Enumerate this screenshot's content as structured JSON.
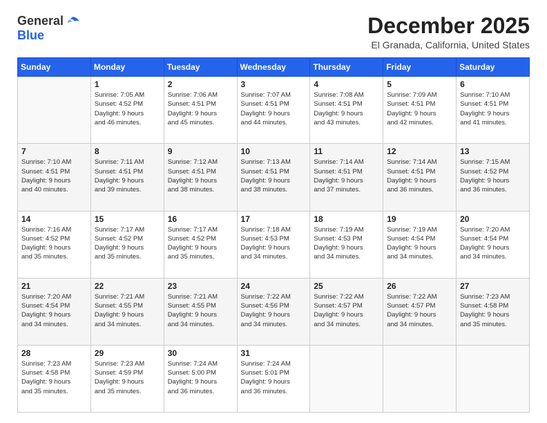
{
  "logo": {
    "general": "General",
    "blue": "Blue"
  },
  "header": {
    "month": "December 2025",
    "location": "El Granada, California, United States"
  },
  "weekdays": [
    "Sunday",
    "Monday",
    "Tuesday",
    "Wednesday",
    "Thursday",
    "Friday",
    "Saturday"
  ],
  "weeks": [
    [
      {
        "day": "",
        "info": ""
      },
      {
        "day": "1",
        "info": "Sunrise: 7:05 AM\nSunset: 4:52 PM\nDaylight: 9 hours\nand 46 minutes."
      },
      {
        "day": "2",
        "info": "Sunrise: 7:06 AM\nSunset: 4:51 PM\nDaylight: 9 hours\nand 45 minutes."
      },
      {
        "day": "3",
        "info": "Sunrise: 7:07 AM\nSunset: 4:51 PM\nDaylight: 9 hours\nand 44 minutes."
      },
      {
        "day": "4",
        "info": "Sunrise: 7:08 AM\nSunset: 4:51 PM\nDaylight: 9 hours\nand 43 minutes."
      },
      {
        "day": "5",
        "info": "Sunrise: 7:09 AM\nSunset: 4:51 PM\nDaylight: 9 hours\nand 42 minutes."
      },
      {
        "day": "6",
        "info": "Sunrise: 7:10 AM\nSunset: 4:51 PM\nDaylight: 9 hours\nand 41 minutes."
      }
    ],
    [
      {
        "day": "7",
        "info": "Sunrise: 7:10 AM\nSunset: 4:51 PM\nDaylight: 9 hours\nand 40 minutes."
      },
      {
        "day": "8",
        "info": "Sunrise: 7:11 AM\nSunset: 4:51 PM\nDaylight: 9 hours\nand 39 minutes."
      },
      {
        "day": "9",
        "info": "Sunrise: 7:12 AM\nSunset: 4:51 PM\nDaylight: 9 hours\nand 38 minutes."
      },
      {
        "day": "10",
        "info": "Sunrise: 7:13 AM\nSunset: 4:51 PM\nDaylight: 9 hours\nand 38 minutes."
      },
      {
        "day": "11",
        "info": "Sunrise: 7:14 AM\nSunset: 4:51 PM\nDaylight: 9 hours\nand 37 minutes."
      },
      {
        "day": "12",
        "info": "Sunrise: 7:14 AM\nSunset: 4:51 PM\nDaylight: 9 hours\nand 36 minutes."
      },
      {
        "day": "13",
        "info": "Sunrise: 7:15 AM\nSunset: 4:52 PM\nDaylight: 9 hours\nand 36 minutes."
      }
    ],
    [
      {
        "day": "14",
        "info": "Sunrise: 7:16 AM\nSunset: 4:52 PM\nDaylight: 9 hours\nand 35 minutes."
      },
      {
        "day": "15",
        "info": "Sunrise: 7:17 AM\nSunset: 4:52 PM\nDaylight: 9 hours\nand 35 minutes."
      },
      {
        "day": "16",
        "info": "Sunrise: 7:17 AM\nSunset: 4:52 PM\nDaylight: 9 hours\nand 35 minutes."
      },
      {
        "day": "17",
        "info": "Sunrise: 7:18 AM\nSunset: 4:53 PM\nDaylight: 9 hours\nand 34 minutes."
      },
      {
        "day": "18",
        "info": "Sunrise: 7:19 AM\nSunset: 4:53 PM\nDaylight: 9 hours\nand 34 minutes."
      },
      {
        "day": "19",
        "info": "Sunrise: 7:19 AM\nSunset: 4:54 PM\nDaylight: 9 hours\nand 34 minutes."
      },
      {
        "day": "20",
        "info": "Sunrise: 7:20 AM\nSunset: 4:54 PM\nDaylight: 9 hours\nand 34 minutes."
      }
    ],
    [
      {
        "day": "21",
        "info": "Sunrise: 7:20 AM\nSunset: 4:54 PM\nDaylight: 9 hours\nand 34 minutes."
      },
      {
        "day": "22",
        "info": "Sunrise: 7:21 AM\nSunset: 4:55 PM\nDaylight: 9 hours\nand 34 minutes."
      },
      {
        "day": "23",
        "info": "Sunrise: 7:21 AM\nSunset: 4:55 PM\nDaylight: 9 hours\nand 34 minutes."
      },
      {
        "day": "24",
        "info": "Sunrise: 7:22 AM\nSunset: 4:56 PM\nDaylight: 9 hours\nand 34 minutes."
      },
      {
        "day": "25",
        "info": "Sunrise: 7:22 AM\nSunset: 4:57 PM\nDaylight: 9 hours\nand 34 minutes."
      },
      {
        "day": "26",
        "info": "Sunrise: 7:22 AM\nSunset: 4:57 PM\nDaylight: 9 hours\nand 34 minutes."
      },
      {
        "day": "27",
        "info": "Sunrise: 7:23 AM\nSunset: 4:58 PM\nDaylight: 9 hours\nand 35 minutes."
      }
    ],
    [
      {
        "day": "28",
        "info": "Sunrise: 7:23 AM\nSunset: 4:58 PM\nDaylight: 9 hours\nand 35 minutes."
      },
      {
        "day": "29",
        "info": "Sunrise: 7:23 AM\nSunset: 4:59 PM\nDaylight: 9 hours\nand 35 minutes."
      },
      {
        "day": "30",
        "info": "Sunrise: 7:24 AM\nSunset: 5:00 PM\nDaylight: 9 hours\nand 36 minutes."
      },
      {
        "day": "31",
        "info": "Sunrise: 7:24 AM\nSunset: 5:01 PM\nDaylight: 9 hours\nand 36 minutes."
      },
      {
        "day": "",
        "info": ""
      },
      {
        "day": "",
        "info": ""
      },
      {
        "day": "",
        "info": ""
      }
    ]
  ]
}
